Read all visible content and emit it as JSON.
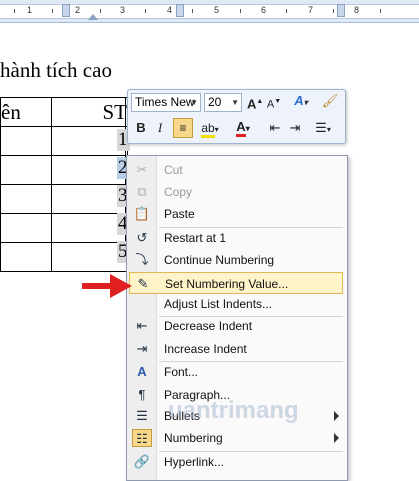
{
  "ruler": {
    "numbers": [
      "1",
      "2",
      "3",
      "4",
      "5",
      "6",
      "7",
      "8"
    ]
  },
  "document": {
    "heading": "hành tích cao",
    "col1_header": "ên",
    "col2_header": "ST",
    "numbers": [
      "1",
      "2",
      "3",
      "4",
      "5"
    ]
  },
  "mini_toolbar": {
    "font_name": "Times New",
    "font_size": "20",
    "bold_label": "B",
    "italic_label": "I"
  },
  "context_menu": {
    "items": [
      {
        "label": "Cut",
        "icon": "scissors-icon",
        "enabled": false
      },
      {
        "label": "Copy",
        "icon": "copy-icon",
        "enabled": false
      },
      {
        "label": "Paste",
        "icon": "paste-icon",
        "enabled": true
      },
      {
        "label": "Restart at 1",
        "icon": "restart-numbering-icon",
        "enabled": true
      },
      {
        "label": "Continue Numbering",
        "icon": "continue-numbering-icon",
        "enabled": true
      },
      {
        "label": "Set Numbering Value...",
        "icon": "set-numbering-value-icon",
        "enabled": true,
        "highlighted": true
      },
      {
        "label": "Adjust List Indents...",
        "icon": "",
        "enabled": true
      },
      {
        "label": "Decrease Indent",
        "icon": "decrease-indent-icon",
        "enabled": true
      },
      {
        "label": "Increase Indent",
        "icon": "increase-indent-icon",
        "enabled": true
      },
      {
        "label": "Font...",
        "icon": "font-icon",
        "enabled": true
      },
      {
        "label": "Paragraph...",
        "icon": "paragraph-icon",
        "enabled": true
      },
      {
        "label": "Bullets",
        "icon": "bullets-icon",
        "enabled": true,
        "submenu": true
      },
      {
        "label": "Numbering",
        "icon": "numbering-icon",
        "enabled": true,
        "submenu": true
      },
      {
        "label": "Hyperlink...",
        "icon": "hyperlink-icon",
        "enabled": true
      }
    ]
  },
  "watermark": "uantrimang",
  "colors": {
    "highlight_fill": "#fff3c9",
    "highlight_border": "#e3b655",
    "arrow": "#e02020",
    "selected_number": "#b9cfe8"
  }
}
